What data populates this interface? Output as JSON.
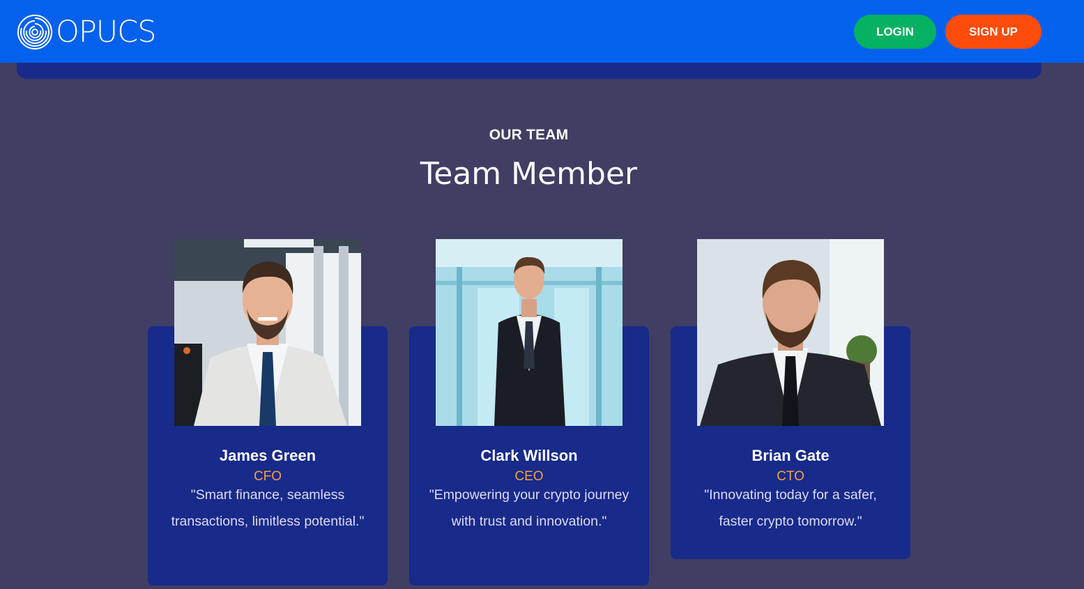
{
  "header": {
    "brand": "OPUCS",
    "login_label": "LOGIN",
    "signup_label": "SIGN UP"
  },
  "section": {
    "eyebrow": "OUR TEAM",
    "title": "Team Member"
  },
  "members": [
    {
      "name": "James Green",
      "role": "CFO",
      "quote": "\"Smart finance, seamless transactions, limitless potential.\""
    },
    {
      "name": "Clark Willson",
      "role": "CEO",
      "quote": "\"Empowering your crypto journey with trust and innovation.\""
    },
    {
      "name": "Brian Gate",
      "role": "CTO",
      "quote": "\"Innovating today for a safer, faster crypto tomorrow.\""
    }
  ],
  "colors": {
    "header": "#0461ee",
    "page_bg": "#403e63",
    "card_bg": "#182a8a",
    "login": "#05b162",
    "signup": "#fe4c0c",
    "role_accent": "#f4a340"
  }
}
